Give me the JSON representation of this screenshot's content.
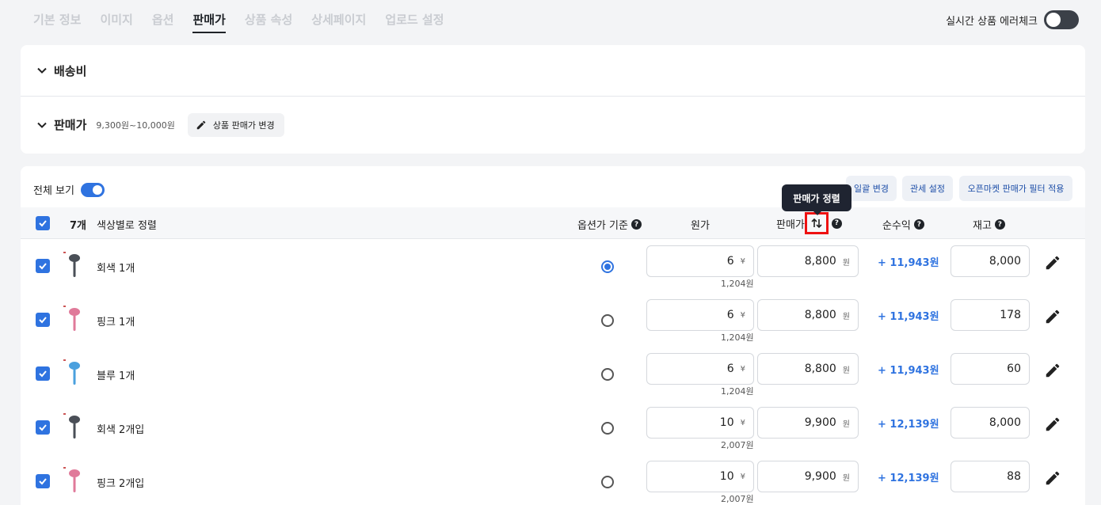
{
  "tabs": [
    "기본 정보",
    "이미지",
    "옵션",
    "판매가",
    "상품 속성",
    "상세페이지",
    "업로드 설정"
  ],
  "active_tab": "판매가",
  "realtime": {
    "label": "실시간 상품 에러체크"
  },
  "sections": {
    "shipping": {
      "title": "배송비"
    },
    "price": {
      "title": "판매가",
      "range": "9,300원~10,000원",
      "change_button": "상품 판매가 변경"
    }
  },
  "view_all": {
    "label": "전체 보기"
  },
  "actions": {
    "bulk_change": "일괄 변경",
    "customs": "관세 설정",
    "openmarket_filter": "오픈마켓 판매가 필터 적용"
  },
  "tooltip": "판매가 정렬",
  "table": {
    "count": "7개",
    "sort_label": "색상별로 정렬",
    "headers": {
      "option_base": "옵션가 기준",
      "cost": "원가",
      "price": "판매가",
      "profit": "순수익",
      "stock": "재고"
    },
    "yen": "¥",
    "won": "원",
    "rows": [
      {
        "name": "회색 1개",
        "cost": "6",
        "cost_won": "1,204원",
        "price": "8,800",
        "profit": "+ 11,943원",
        "stock": "8,000",
        "selected": true,
        "color": "#4a4f57"
      },
      {
        "name": "핑크 1개",
        "cost": "6",
        "cost_won": "1,204원",
        "price": "8,800",
        "profit": "+ 11,943원",
        "stock": "178",
        "selected": false,
        "color": "#e07a9a"
      },
      {
        "name": "블루 1개",
        "cost": "6",
        "cost_won": "1,204원",
        "price": "8,800",
        "profit": "+ 11,943원",
        "stock": "60",
        "selected": false,
        "color": "#4aa0de"
      },
      {
        "name": "회색 2개입",
        "cost": "10",
        "cost_won": "2,007원",
        "price": "9,900",
        "profit": "+ 12,139원",
        "stock": "8,000",
        "selected": false,
        "color": "#4a4f57"
      },
      {
        "name": "핑크 2개입",
        "cost": "10",
        "cost_won": "2,007원",
        "price": "9,900",
        "profit": "+ 12,139원",
        "stock": "88",
        "selected": false,
        "color": "#e07a9a"
      }
    ]
  }
}
